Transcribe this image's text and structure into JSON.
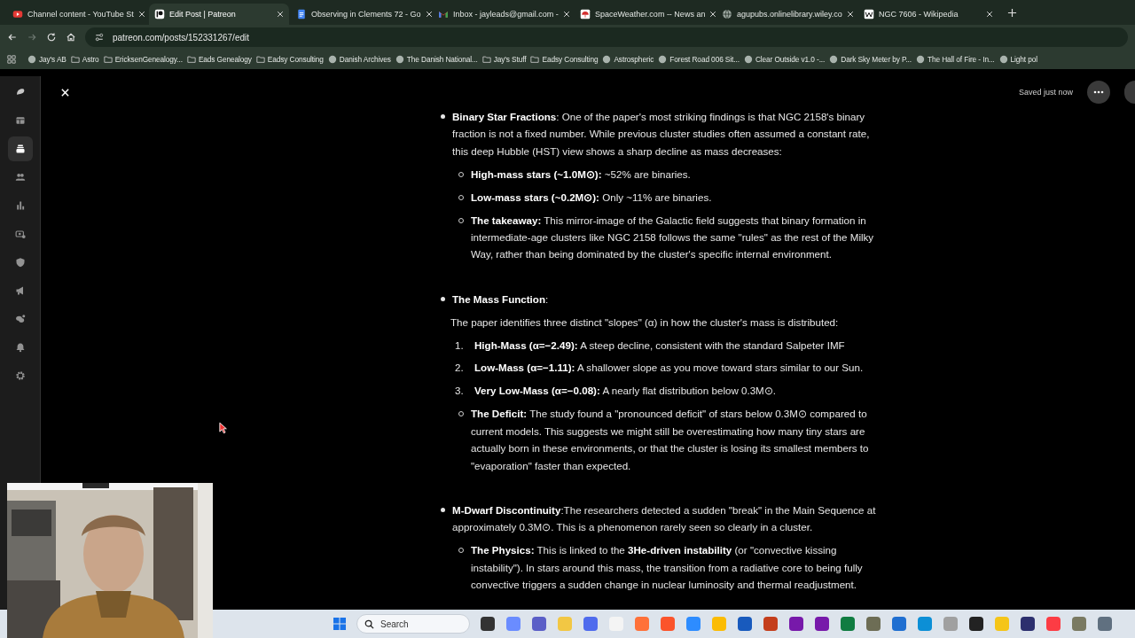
{
  "tabs": [
    {
      "title": "Channel content - YouTube St",
      "selected": false
    },
    {
      "title": "Edit Post | Patreon",
      "selected": true
    },
    {
      "title": "Observing in Clements 72 - Go",
      "selected": false
    },
    {
      "title": "Inbox - jayleads@gmail.com -",
      "selected": false
    },
    {
      "title": "SpaceWeather.com -- News an",
      "selected": false
    },
    {
      "title": "agupubs.onlinelibrary.wiley.co",
      "selected": false
    },
    {
      "title": "NGC 7606 - Wikipedia",
      "selected": false
    }
  ],
  "address_bar": {
    "url": "patreon.com/posts/152331267/edit"
  },
  "bookmarks": [
    {
      "label": "Jay's AB",
      "kind": "site"
    },
    {
      "label": "Astro",
      "kind": "folder"
    },
    {
      "label": "EricksenGenealogy...",
      "kind": "folder"
    },
    {
      "label": "Eads Genealogy",
      "kind": "folder"
    },
    {
      "label": "Eadsy Consulting",
      "kind": "folder"
    },
    {
      "label": "Danish Archives",
      "kind": "site"
    },
    {
      "label": "The Danish National...",
      "kind": "site"
    },
    {
      "label": "Jay's Stuff",
      "kind": "folder"
    },
    {
      "label": "Eadsy Consulting",
      "kind": "folder"
    },
    {
      "label": "Astrospheric",
      "kind": "site"
    },
    {
      "label": "Forest Road 006 Sit...",
      "kind": "site"
    },
    {
      "label": "Clear Outside v1.0 -...",
      "kind": "site"
    },
    {
      "label": "Dark Sky Meter by P...",
      "kind": "site"
    },
    {
      "label": "The Hall of Fire - In...",
      "kind": "site"
    },
    {
      "label": "Light pol",
      "kind": "site"
    }
  ],
  "sidebar": {
    "items": [
      {
        "selected": false
      },
      {
        "selected": false
      },
      {
        "selected": true
      },
      {
        "selected": false
      },
      {
        "selected": false
      },
      {
        "selected": false
      },
      {
        "selected": false
      },
      {
        "selected": false
      },
      {
        "selected": false
      },
      {
        "selected": false
      },
      {
        "selected": false
      }
    ]
  },
  "editor": {
    "status": "Saved just now"
  },
  "article": {
    "blocks": [
      {
        "text": "**Binary Star Fractions**: One of the paper's most striking findings is that NGC 2158's binary fraction is not a fixed number. While previous cluster studies often assumed a constant rate, this deep Hubble (HST) view shows a sharp decline as mass decreases:",
        "children": [
          {
            "kind": "sub",
            "text": "**High-mass stars (~1.0M⊙):** ~52% are binaries."
          },
          {
            "kind": "sub",
            "text": "**Low-mass stars (~0.2M⊙):** Only ~11% are binaries."
          },
          {
            "kind": "sub",
            "text": "**The takeaway:** This mirror-image of the Galactic field suggests that binary formation in intermediate-age clusters like NGC 2158 follows the same \"rules\" as the rest of the Milky Way, rather than being dominated by the cluster's specific internal environment."
          }
        ]
      },
      {
        "text": "**The Mass Function**:",
        "children": [
          {
            "kind": "para",
            "text": "The paper identifies three distinct \"slopes\" (α) in how the cluster's mass is distributed:"
          },
          {
            "kind": "numbered",
            "number": "1.",
            "text": "**High-Mass (α=−2.49):** A steep decline, consistent with the standard Salpeter IMF"
          },
          {
            "kind": "numbered",
            "number": "2.",
            "text": "**Low-Mass (α=−1.11):** A shallower slope as you move toward stars similar to our Sun."
          },
          {
            "kind": "numbered",
            "number": "3.",
            "text": "**Very Low-Mass (α=−0.08):** A nearly flat distribution below 0.3M⊙."
          },
          {
            "kind": "sub",
            "text": "**The Deficit:** The study found a \"pronounced deficit\" of stars below 0.3M⊙ compared to current models. This suggests we might still be overestimating how many tiny stars are actually born in these environments, or that the cluster is losing its smallest members to \"evaporation\" faster than expected."
          }
        ]
      },
      {
        "text": "**M-Dwarf Discontinuity**:The researchers detected a sudden \"break\" in the Main Sequence at approximately 0.3M⊙. This is a phenomenon rarely seen so clearly in a cluster.",
        "children": [
          {
            "kind": "sub",
            "text": "**The Physics:** This is linked to the **3He-driven instability** (or \"convective kissing instability\"). In stars around this mass, the transition from a radiative core to being fully convective triggers a sudden change in nuclear luminosity and thermal readjustment."
          }
        ]
      }
    ]
  },
  "taskbar": {
    "search": {
      "placeholder": "Search"
    }
  }
}
